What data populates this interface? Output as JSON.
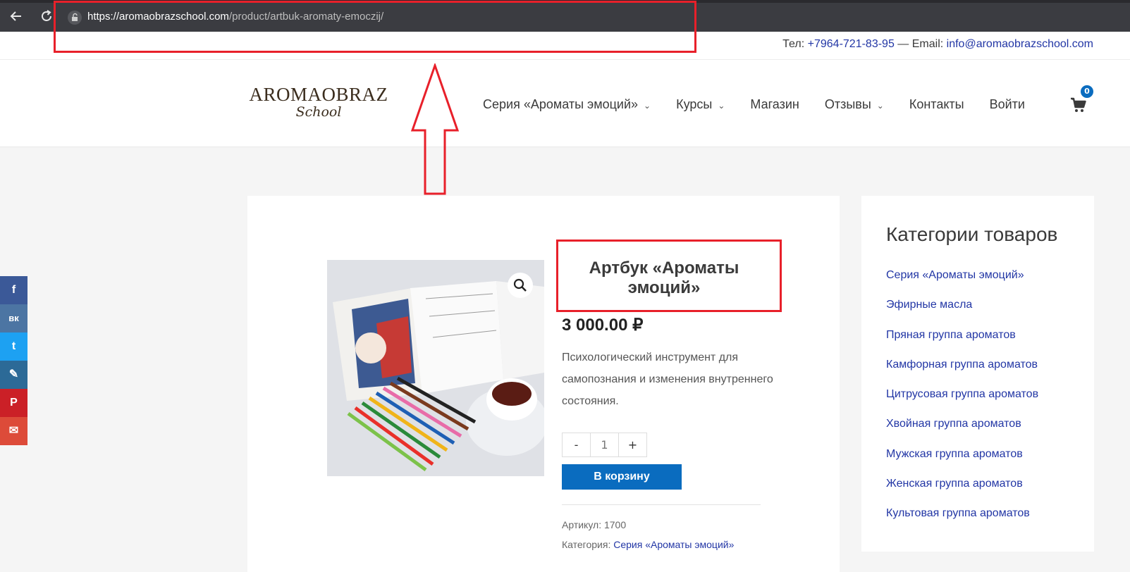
{
  "browser": {
    "url_host": "https://aromaobrazschool.com",
    "url_path": "/product/artbuk-aromaty-emoczij/",
    "back_icon": "arrow-left-icon",
    "reload_icon": "reload-icon",
    "site_info_icon": "lock-icon"
  },
  "topbar": {
    "tel_label": "Тел:",
    "tel": "+7964-721-83-95",
    "separator": "— Email:",
    "email": "info@aromaobrazschool.com"
  },
  "header": {
    "logo_main": "AROMAOBRAZ",
    "logo_sub": "School",
    "menu": [
      {
        "label": "Серия «Ароматы эмоций»",
        "has_dropdown": true
      },
      {
        "label": "Курсы",
        "has_dropdown": true
      },
      {
        "label": "Магазин",
        "has_dropdown": false
      },
      {
        "label": "Отзывы",
        "has_dropdown": true
      },
      {
        "label": "Контакты",
        "has_dropdown": false
      },
      {
        "label": "Войти",
        "has_dropdown": false
      }
    ],
    "cart_count": "0"
  },
  "product": {
    "title": "Артбук «Ароматы эмоций»",
    "price": "3 000.00 ₽",
    "description": "Психологический инструмент для самопознания и изменения внутреннего состояния.",
    "qty_minus": "-",
    "qty_value": "1",
    "qty_plus": "+",
    "add_to_cart": "В корзину",
    "sku_label": "Артикул:",
    "sku": "1700",
    "category_label": "Категория:",
    "category": "Серия «Ароматы эмоций»"
  },
  "sidebar": {
    "title": "Категории товаров",
    "categories": [
      "Серия «Ароматы эмоций»",
      "Эфирные масла",
      "Пряная группа ароматов",
      "Камфорная группа ароматов",
      "Цитрусовая группа ароматов",
      "Хвойная группа ароматов",
      "Мужская группа ароматов",
      "Женская группа ароматов",
      "Культовая группа ароматов"
    ]
  },
  "social": [
    {
      "icon": "facebook-icon",
      "glyph": "f",
      "color": "#3b5998"
    },
    {
      "icon": "vk-icon",
      "glyph": "вк",
      "color": "#4c75a3"
    },
    {
      "icon": "twitter-icon",
      "glyph": "t",
      "color": "#1da1f2"
    },
    {
      "icon": "livejournal-icon",
      "glyph": "✎",
      "color": "#2c6a97"
    },
    {
      "icon": "pinterest-icon",
      "glyph": "P",
      "color": "#cb2027"
    },
    {
      "icon": "email-icon",
      "glyph": "✉",
      "color": "#dd4b39"
    }
  ],
  "colors": {
    "accent": "#0a6cbf",
    "link": "#2236a5",
    "annotation": "#e8202a"
  }
}
